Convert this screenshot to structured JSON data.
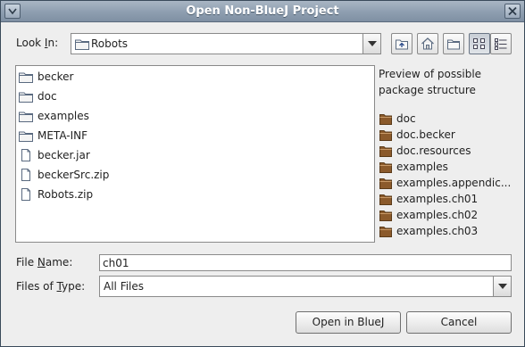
{
  "window": {
    "title": "Open Non-BlueJ Project"
  },
  "look_in": {
    "label_pre": "Look ",
    "label_mn": "I",
    "label_post": "n:",
    "value": "Robots",
    "icon": "folder-icon"
  },
  "toolbar": {
    "icons": [
      "up-folder-icon",
      "home-icon",
      "new-folder-icon",
      "list-view-icon",
      "details-view-icon"
    ]
  },
  "files": [
    {
      "name": "becker",
      "type": "folder"
    },
    {
      "name": "doc",
      "type": "folder"
    },
    {
      "name": "examples",
      "type": "folder"
    },
    {
      "name": "META-INF",
      "type": "folder"
    },
    {
      "name": "becker.jar",
      "type": "file"
    },
    {
      "name": "beckerSrc.zip",
      "type": "file"
    },
    {
      "name": "Robots.zip",
      "type": "file"
    }
  ],
  "preview": {
    "header": "Preview of possible package structure",
    "packages": [
      "doc",
      "doc.becker",
      "doc.resources",
      "examples",
      "examples.appendic...",
      "examples.ch01",
      "examples.ch02",
      "examples.ch03"
    ]
  },
  "file_name": {
    "label_pre": "File ",
    "label_mn": "N",
    "label_post": "ame:",
    "value": "ch01"
  },
  "files_of_type": {
    "label_pre": "Files of ",
    "label_mn": "T",
    "label_post": "ype:",
    "value": "All Files"
  },
  "buttons": {
    "open": "Open in BlueJ",
    "cancel": "Cancel"
  },
  "colors": {
    "folder_brown": "#8b5a2b",
    "title_bar": "#8e9eb0"
  }
}
